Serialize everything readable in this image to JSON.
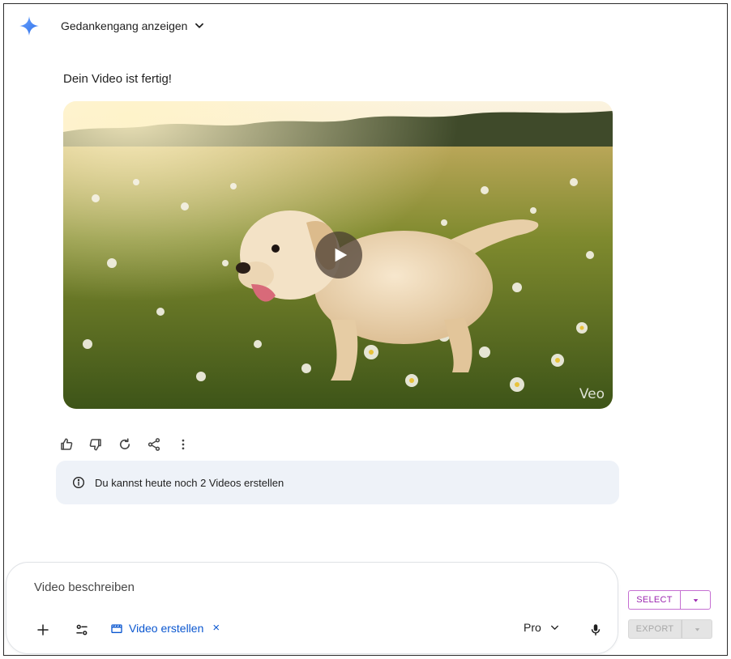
{
  "header": {
    "thought_toggle_label": "Gedankengang anzeigen",
    "brand_color": "#4285f4"
  },
  "message": {
    "text": "Dein Video ist fertig!",
    "video": {
      "watermark": "Veo",
      "play_icon": "play-icon"
    }
  },
  "actions": {
    "icons": [
      "thumbs-up-icon",
      "thumbs-down-icon",
      "refresh-icon",
      "share-icon",
      "more-vert-icon"
    ]
  },
  "notice": {
    "icon": "info-icon",
    "text": "Du kannst heute noch 2 Videos erstellen"
  },
  "composer": {
    "placeholder": "Video beschreiben",
    "tool_chip_label": "Video erstellen",
    "tool_chip_close": "×",
    "model_label": "Pro",
    "accent_color": "#0b57d0"
  },
  "side_buttons": {
    "select_label": "SELECT",
    "export_label": "EXPORT",
    "select_color": "#9c27b0"
  }
}
